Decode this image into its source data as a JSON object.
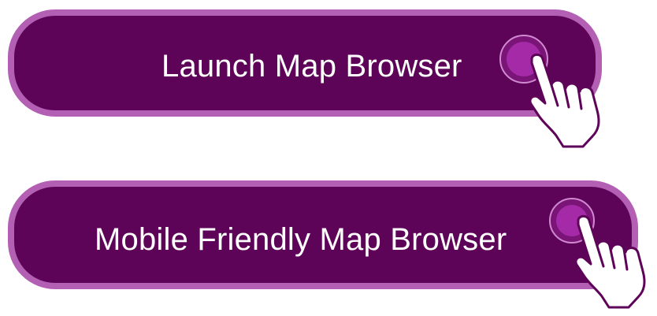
{
  "buttons": [
    {
      "label": "Launch Map Browser"
    },
    {
      "label": "Mobile Friendly Map Browser"
    }
  ],
  "colors": {
    "button_fill": "#5e0458",
    "button_border": "#b35fb3",
    "label_text": "#ffffff",
    "pointer_target": "#a52aa8",
    "hand_fill": "#ffffff",
    "hand_outline": "#5e0458"
  },
  "icons": {
    "pointer": "hand-pointer-icon",
    "target": "click-target-icon"
  }
}
